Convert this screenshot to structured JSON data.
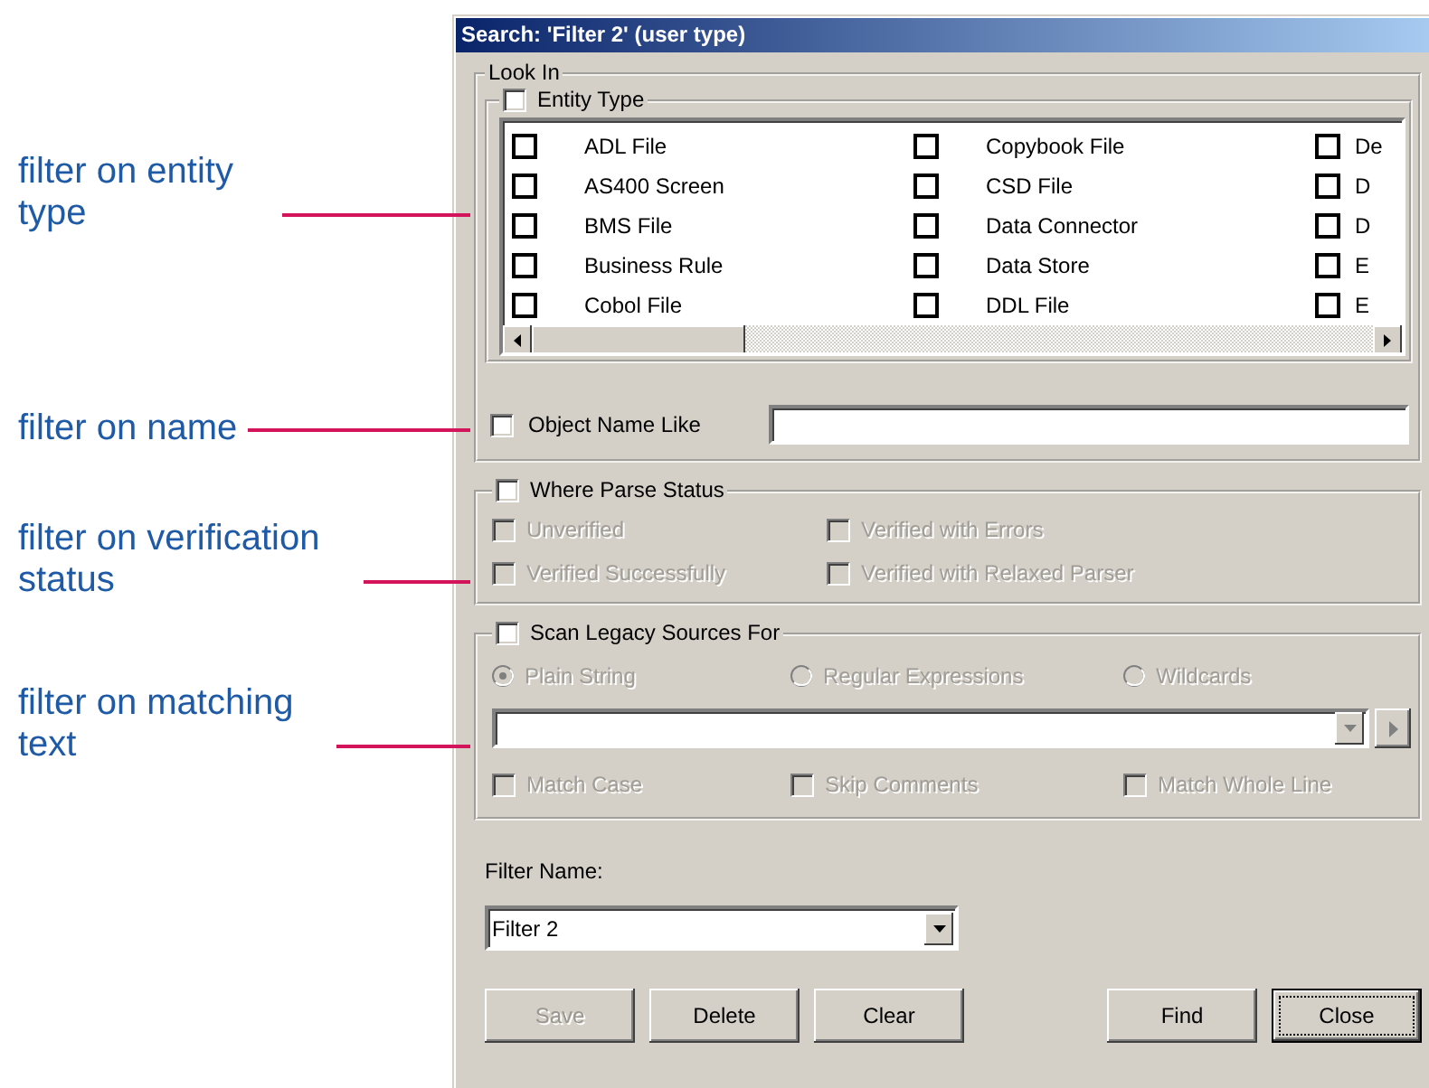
{
  "annotations": [
    {
      "text": "filter on entity type"
    },
    {
      "text": "filter on name"
    },
    {
      "text": "filter on verification status"
    },
    {
      "text": "filter on matching text"
    }
  ],
  "window": {
    "title": "Search: 'Filter 2' (user type)"
  },
  "look_in": {
    "label": "Look In",
    "entity_type": {
      "label": "Entity Type",
      "checked": false,
      "columns": [
        [
          {
            "label": "ADL File",
            "checked": false
          },
          {
            "label": "AS400 Screen",
            "checked": false
          },
          {
            "label": "BMS File",
            "checked": false
          },
          {
            "label": "Business Rule",
            "checked": false
          },
          {
            "label": "Cobol File",
            "checked": false
          }
        ],
        [
          {
            "label": "Copybook File",
            "checked": false
          },
          {
            "label": "CSD File",
            "checked": false
          },
          {
            "label": "Data Connector",
            "checked": false
          },
          {
            "label": "Data Store",
            "checked": false
          },
          {
            "label": "DDL File",
            "checked": false
          }
        ],
        [
          {
            "label": "De",
            "checked": false
          },
          {
            "label": "D",
            "checked": false
          },
          {
            "label": "D",
            "checked": false
          },
          {
            "label": "E",
            "checked": false
          },
          {
            "label": "E",
            "checked": false
          }
        ]
      ]
    },
    "object_name_like": {
      "label": "Object Name Like",
      "checked": false
    }
  },
  "parse_status": {
    "label": "Where Parse Status",
    "checked": false,
    "options": [
      {
        "label": "Unverified",
        "checked": false,
        "disabled": true
      },
      {
        "label": "Verified Successfully",
        "checked": false,
        "disabled": true
      },
      {
        "label": "Verified with Errors",
        "checked": false,
        "disabled": true
      },
      {
        "label": "Verified with Relaxed Parser",
        "checked": false,
        "disabled": true
      }
    ]
  },
  "scan": {
    "label": "Scan Legacy Sources For",
    "checked": false,
    "disabled": true,
    "modes": [
      {
        "label": "Plain String",
        "selected": true
      },
      {
        "label": "Regular Expressions",
        "selected": false
      },
      {
        "label": "Wildcards",
        "selected": false
      }
    ],
    "options": [
      {
        "label": "Match Case",
        "checked": false
      },
      {
        "label": "Skip Comments",
        "checked": false
      },
      {
        "label": "Match Whole Line",
        "checked": false
      }
    ]
  },
  "filter_name": {
    "label": "Filter Name:",
    "value": "Filter 2"
  },
  "buttons": [
    {
      "label": "Save",
      "disabled": true,
      "default": false
    },
    {
      "label": "Delete",
      "disabled": false,
      "default": false
    },
    {
      "label": "Clear",
      "disabled": false,
      "default": false
    },
    {
      "label": "Find",
      "disabled": false,
      "default": false
    },
    {
      "label": "Close",
      "disabled": false,
      "default": true
    }
  ]
}
